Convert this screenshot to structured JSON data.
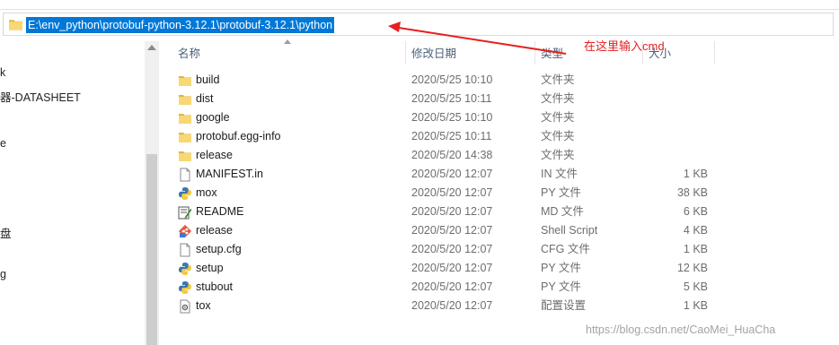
{
  "address_bar": {
    "path": "E:\\env_python\\protobuf-python-3.12.1\\protobuf-3.12.1\\python"
  },
  "nav": {
    "items": [
      "k",
      "器-DATASHEET",
      "e",
      "盘",
      "g"
    ]
  },
  "columns": {
    "name": "名称",
    "date": "修改日期",
    "type": "类型",
    "size": "大小"
  },
  "files": [
    {
      "name": "build",
      "date": "2020/5/25 10:10",
      "type": "文件夹",
      "size": "",
      "icon": "folder-icon"
    },
    {
      "name": "dist",
      "date": "2020/5/25 10:11",
      "type": "文件夹",
      "size": "",
      "icon": "folder-icon"
    },
    {
      "name": "google",
      "date": "2020/5/25 10:10",
      "type": "文件夹",
      "size": "",
      "icon": "folder-icon"
    },
    {
      "name": "protobuf.egg-info",
      "date": "2020/5/25 10:11",
      "type": "文件夹",
      "size": "",
      "icon": "folder-icon"
    },
    {
      "name": "release",
      "date": "2020/5/20 14:38",
      "type": "文件夹",
      "size": "",
      "icon": "folder-icon"
    },
    {
      "name": "MANIFEST.in",
      "date": "2020/5/20 12:07",
      "type": "IN 文件",
      "size": "1 KB",
      "icon": "file-icon"
    },
    {
      "name": "mox",
      "date": "2020/5/20 12:07",
      "type": "PY 文件",
      "size": "38 KB",
      "icon": "python-icon"
    },
    {
      "name": "README",
      "date": "2020/5/20 12:07",
      "type": "MD 文件",
      "size": "6 KB",
      "icon": "markdown-edit-icon"
    },
    {
      "name": "release",
      "date": "2020/5/20 12:07",
      "type": "Shell Script",
      "size": "4 KB",
      "icon": "git-script-icon"
    },
    {
      "name": "setup.cfg",
      "date": "2020/5/20 12:07",
      "type": "CFG 文件",
      "size": "1 KB",
      "icon": "file-icon"
    },
    {
      "name": "setup",
      "date": "2020/5/20 12:07",
      "type": "PY 文件",
      "size": "12 KB",
      "icon": "python-icon"
    },
    {
      "name": "stubout",
      "date": "2020/5/20 12:07",
      "type": "PY 文件",
      "size": "5 KB",
      "icon": "python-icon"
    },
    {
      "name": "tox",
      "date": "2020/5/20 12:07",
      "type": "配置设置",
      "size": "1 KB",
      "icon": "settings-file-icon"
    }
  ],
  "annotation": {
    "text": "在这里输入cmd",
    "color": "#e81e1e"
  },
  "watermark": "https://blog.csdn.net/CaoMei_HuaCha",
  "colors": {
    "selection": "#0078d7",
    "header_text": "#4c607a",
    "folder": "#f8d775"
  }
}
